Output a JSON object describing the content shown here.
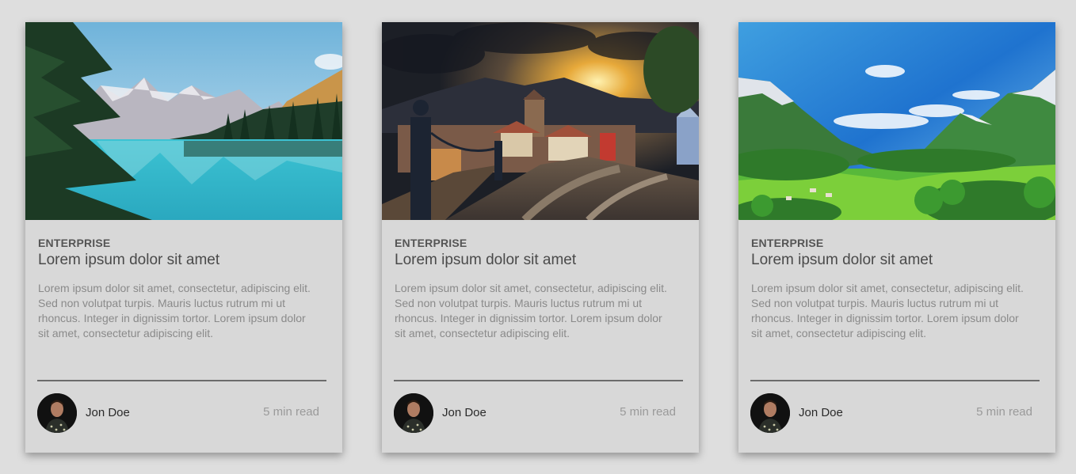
{
  "cards": [
    {
      "image_icon": "lake-mountain-photo",
      "category": "ENTERPRISE",
      "title": "Lorem ipsum dolor sit amet",
      "description": "Lorem ipsum dolor sit amet, consectetur, adipiscing elit. Sed non volutpat turpis. Mauris luctus rutrum mi ut rhoncus. Integer in dignissim tortor. Lorem ipsum dolor sit amet, consectetur adipiscing elit.",
      "author": "Jon Doe",
      "read_time": "5 min read"
    },
    {
      "image_icon": "village-sunset-photo",
      "category": "ENTERPRISE",
      "title": "Lorem ipsum dolor sit amet",
      "description": "Lorem ipsum dolor sit amet, consectetur, adipiscing elit. Sed non volutpat turpis. Mauris luctus rutrum mi ut rhoncus. Integer in dignissim tortor. Lorem ipsum dolor sit amet, consectetur adipiscing elit.",
      "author": "Jon Doe",
      "read_time": "5 min read"
    },
    {
      "image_icon": "alpine-valley-photo",
      "category": "ENTERPRISE",
      "title": "Lorem ipsum dolor sit amet",
      "description": "Lorem ipsum dolor sit amet, consectetur, adipiscing elit. Sed non volutpat turpis. Mauris luctus rutrum mi ut rhoncus. Integer in dignissim tortor. Lorem ipsum dolor sit amet, consectetur adipiscing elit.",
      "author": "Jon Doe",
      "read_time": "5 min read"
    }
  ],
  "colors": {
    "page_background": "#dedede",
    "card_background": "#d8d8d8",
    "divider": "#6b6b6b"
  }
}
